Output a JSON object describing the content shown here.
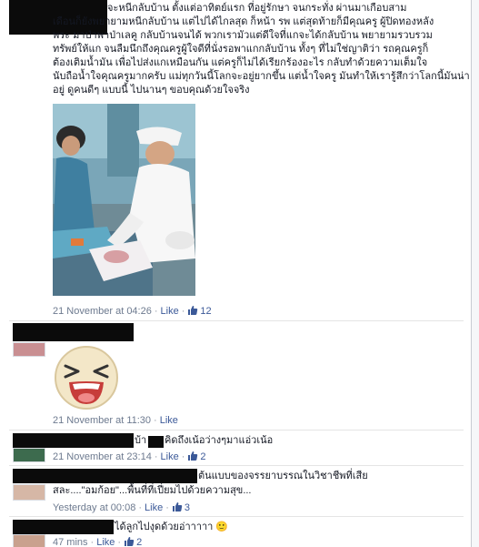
{
  "post": {
    "lines": [
      "จะหนีกลับบ้าน ตั้งแต่อาทิตย์แรก ที่อยู่รักษา จนกระทั่ง ผ่านมาเกือบสาม",
      "เดือนก็ยังพยายามหนีกลับบ้าน แต่ไปได้ไกลสุด ก็หน้า รพ แต่สุดท้ายก็มีคุณครู ผู้ปิดทองหลัง",
      "พระ มาป่าพาป่าเลคู กลับบ้านจนได้ พวกเรามัวแต่ดีใจที่แกจะได้กลับบ้าน พยายามรวบรวม",
      "ทรัพย์ให้แก จนลืมนึกถึงคุณครูผู้ใจดีที่นั่งรอพาแกกลับบ้าน ทั้งๆ ที่ไม่ใช่ญาติว่า รถคุณครูก็",
      "ต้องเติมน้ำมัน เพื่อไปส่งแกเหมือนกัน แต่ครูก็ไม่ได้เรียกร้องอะไร กลับทำด้วยความเต็มใจ",
      "นับถือน้ำใจคุณครูมากครับ แม่ทุกวันนี้โลกจะอยู่ยากขึ้น แต่น้ำใจครู มันทำให้เรารู้สึกว่าโลกนี้มันน่า",
      "อยู่ ดูคนดีๆ แบบนี้ ไปนานๆ ขอบคุณด้วยใจจริง"
    ],
    "timestamp": "21 November at 04:26",
    "like_label": "Like",
    "like_count": "12"
  },
  "comments": [
    {
      "text": "",
      "timestamp": "21 November at 11:30",
      "like_label": "Like",
      "like_count": ""
    },
    {
      "text": "บ้า",
      "text2": "คิดถึงเน้อว่างๆมาแอ่วเน้อ",
      "timestamp": "21 November at 23:14",
      "like_label": "Like",
      "like_count": "2"
    },
    {
      "text": "ต้นแบบของจรรยาบรรณในวิชาชีพที่เสีย",
      "text2": "สละ....\"อมก้อย\"...พื้นที่ที่เปี่ยมไปด้วยความสุข...",
      "timestamp": "Yesterday at 00:08",
      "like_label": "Like",
      "like_count": "3"
    },
    {
      "text": "ได้ลูกไปงุดด้วยอ่าาาาา 🙂",
      "timestamp": "47 mins",
      "like_label": "Like",
      "like_count": "2"
    }
  ],
  "colors": {
    "link": "#3b5998",
    "meta": "#6d7a8f",
    "text": "#141823",
    "redaction": "#0b0b0b"
  },
  "icons": [
    "thumbs-up-icon",
    "smiley-emoticon",
    "laughing-face-sticker"
  ]
}
